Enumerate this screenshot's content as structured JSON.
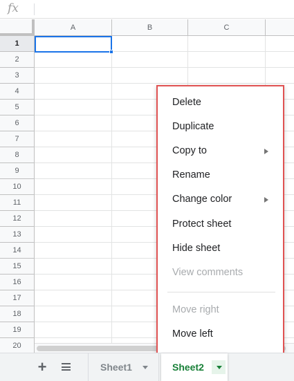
{
  "formula_bar": {
    "fx_label": "fx",
    "value": ""
  },
  "columns": [
    "A",
    "B",
    "C",
    ""
  ],
  "rows": [
    {
      "num": "1"
    },
    {
      "num": "2"
    },
    {
      "num": "3"
    },
    {
      "num": "4"
    },
    {
      "num": "5"
    },
    {
      "num": "6"
    },
    {
      "num": "7"
    },
    {
      "num": "8"
    },
    {
      "num": "9"
    },
    {
      "num": "10"
    },
    {
      "num": "11"
    },
    {
      "num": "12"
    },
    {
      "num": "13"
    },
    {
      "num": "14"
    },
    {
      "num": "15"
    },
    {
      "num": "16"
    },
    {
      "num": "17"
    },
    {
      "num": "18"
    },
    {
      "num": "19"
    },
    {
      "num": "20"
    }
  ],
  "selected_cell": "A1",
  "context_menu": {
    "items": [
      {
        "label": "Delete",
        "disabled": false,
        "submenu": false
      },
      {
        "label": "Duplicate",
        "disabled": false,
        "submenu": false
      },
      {
        "label": "Copy to",
        "disabled": false,
        "submenu": true
      },
      {
        "label": "Rename",
        "disabled": false,
        "submenu": false
      },
      {
        "label": "Change color",
        "disabled": false,
        "submenu": true
      },
      {
        "label": "Protect sheet",
        "disabled": false,
        "submenu": false
      },
      {
        "label": "Hide sheet",
        "disabled": false,
        "submenu": false
      },
      {
        "label": "View comments",
        "disabled": true,
        "submenu": false
      },
      {
        "label": "Move right",
        "disabled": true,
        "submenu": false
      },
      {
        "label": "Move left",
        "disabled": false,
        "submenu": false
      }
    ]
  },
  "sheet_bar": {
    "add_icon": "plus-icon",
    "all_sheets_icon": "menu-icon",
    "tabs": [
      {
        "label": "Sheet1",
        "active": false
      },
      {
        "label": "Sheet2",
        "active": true
      }
    ]
  },
  "colors": {
    "selection": "#1a73e8",
    "active_tab_text": "#188038",
    "menu_highlight_border": "#e05252",
    "disabled_text": "#a8abae"
  }
}
